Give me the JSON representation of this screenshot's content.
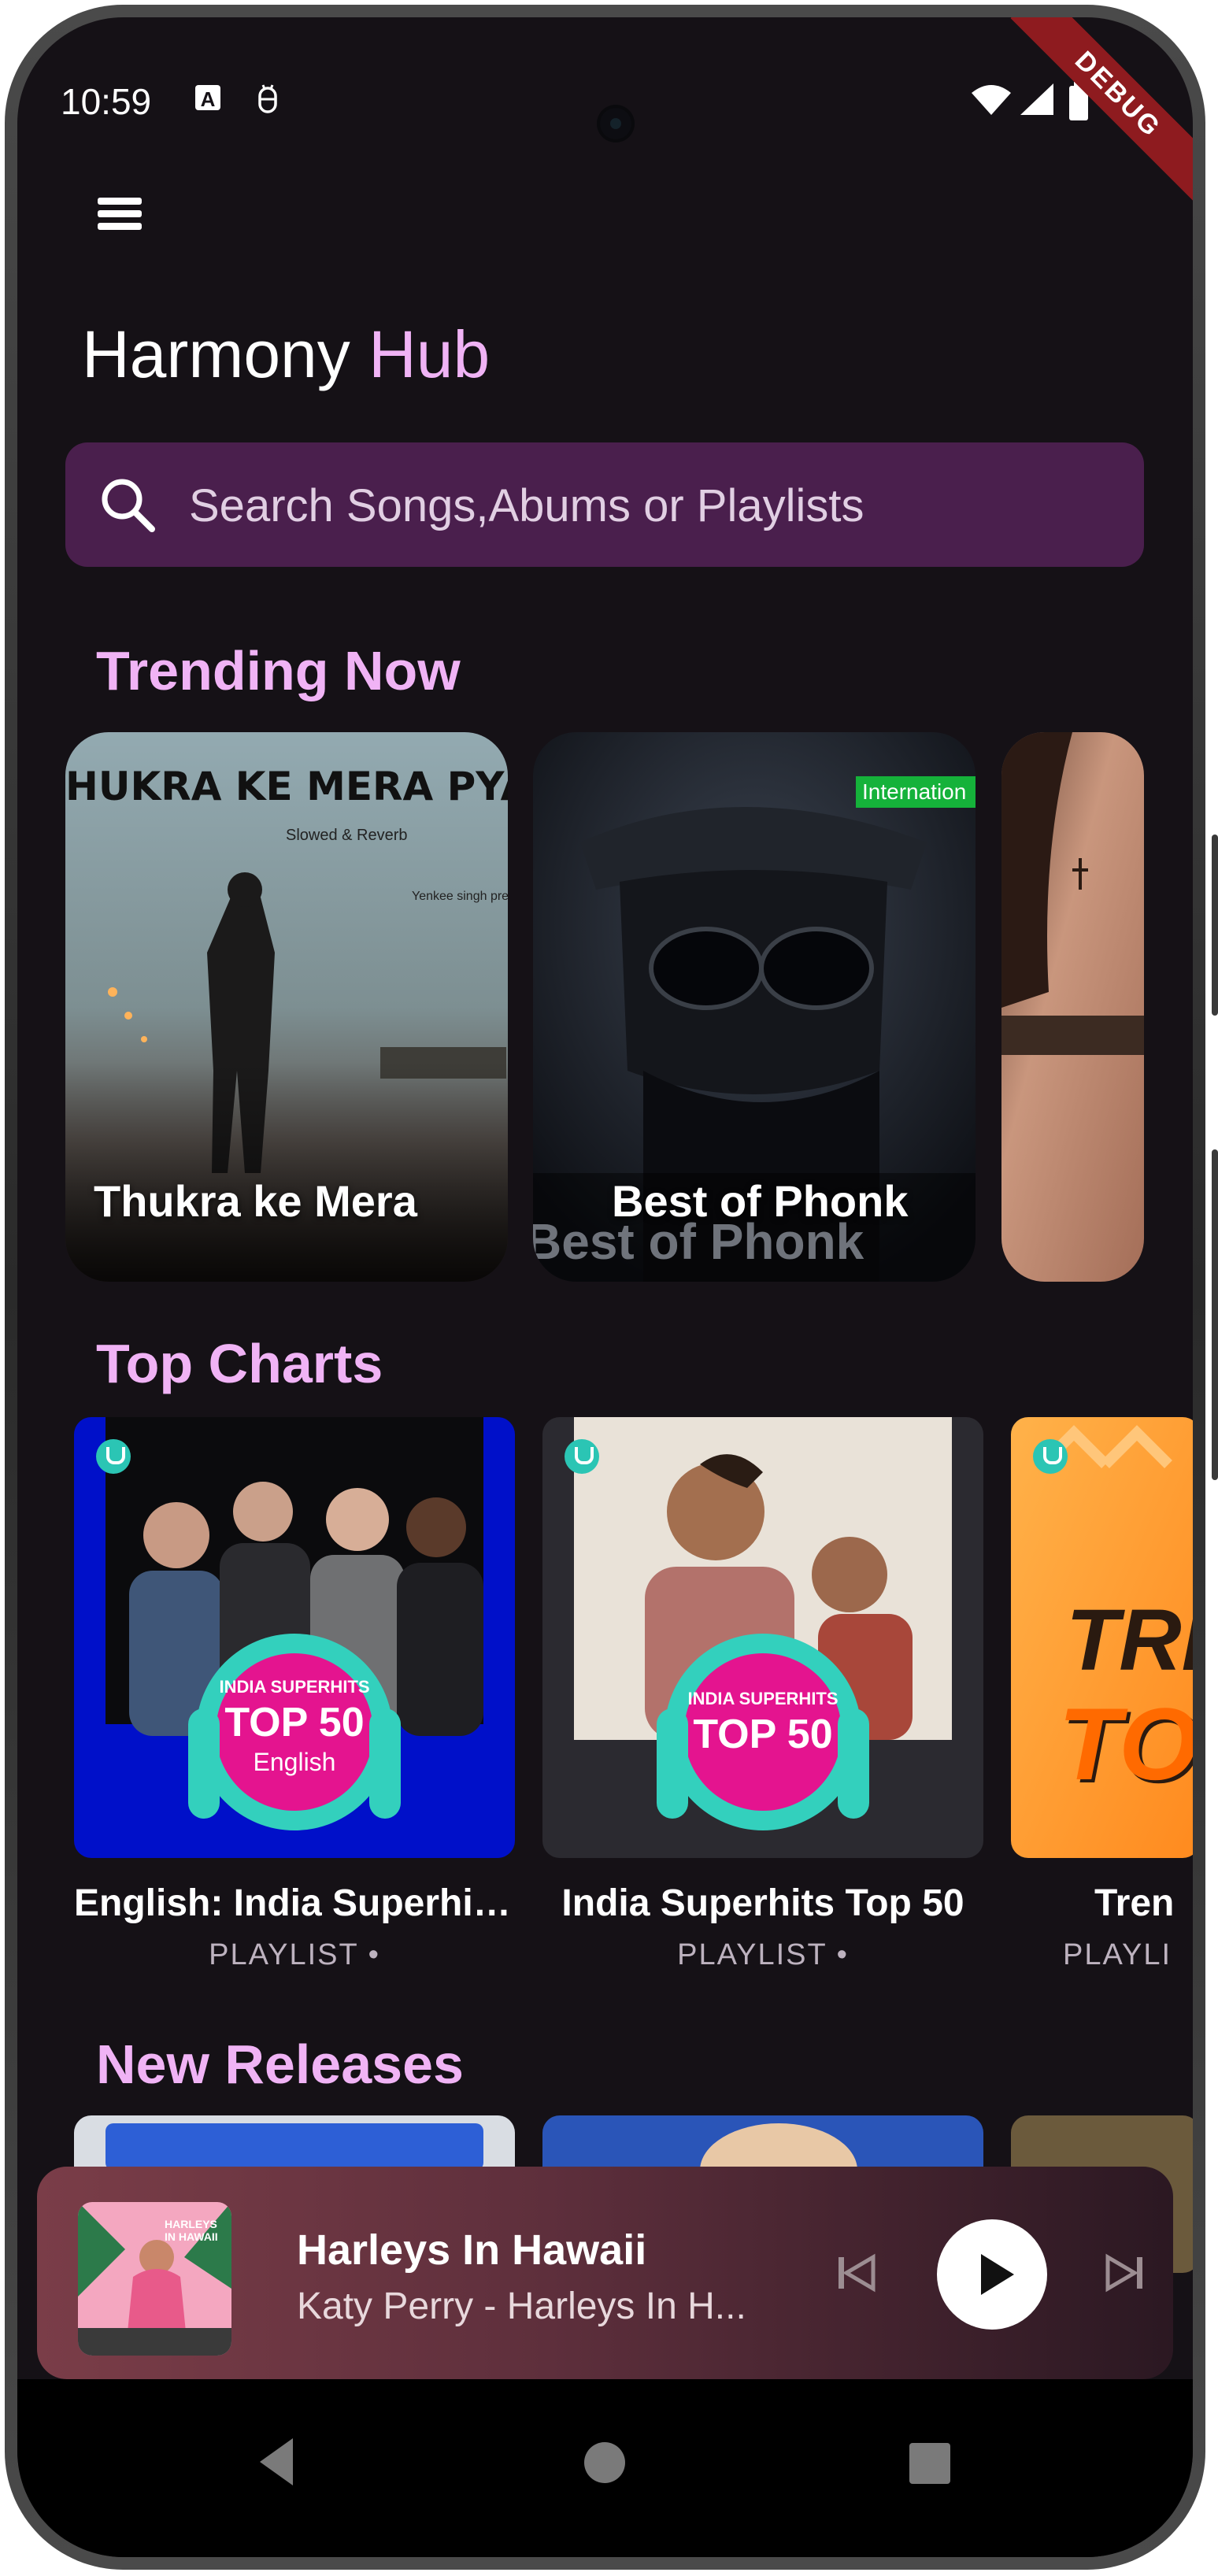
{
  "status_bar": {
    "time": "10:59",
    "debug_label": "DEBUG"
  },
  "app": {
    "title_main": "Harmony",
    "title_accent": "Hub"
  },
  "search": {
    "placeholder": "Search Songs,Abums or Playlists"
  },
  "sections": {
    "trending": "Trending Now",
    "top_charts": "Top Charts",
    "new_releases": "New Releases"
  },
  "trending": [
    {
      "label": "Thukra ke Mera",
      "art_text": "HUKRA KE MERA PYAR",
      "art_sub": "Slowed & Reverb",
      "art_credit": "Yenkee singh pres"
    },
    {
      "label": "Best of Phonk",
      "art_overlay": "Best of Phonk",
      "badge": "Internation"
    },
    {
      "label": ""
    }
  ],
  "top_charts": [
    {
      "title": "English: India Superhit...",
      "subtitle": "PLAYLIST  •",
      "badge_line1": "INDIA SUPERHITS",
      "badge_line2": "TOP 50",
      "badge_line3": "English"
    },
    {
      "title": "India Superhits Top 50",
      "subtitle": "PLAYLIST  •",
      "badge_line1": "INDIA SUPERHITS",
      "badge_line2": "TOP 50"
    },
    {
      "title": "Tren",
      "subtitle": "PLAYLI",
      "art_text1": "TRE",
      "art_text2": "TO"
    }
  ],
  "now_playing": {
    "title": "Harleys In Hawaii",
    "artist": "Katy Perry - Harleys In H...",
    "art_text": "HARLEYS IN HAWAII"
  },
  "colors": {
    "background": "#151116",
    "accent": "#f0b3f5",
    "search_bg": "#4a1f4d"
  }
}
